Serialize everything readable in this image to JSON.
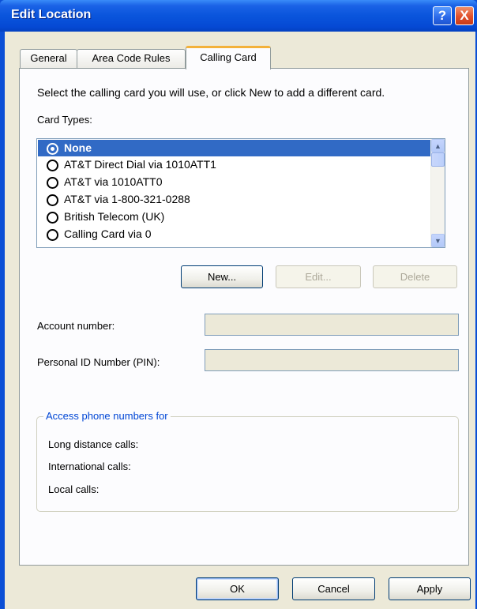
{
  "window": {
    "title": "Edit Location",
    "help_label": "?",
    "close_label": "X"
  },
  "tabs": [
    {
      "label": "General"
    },
    {
      "label": "Area Code Rules"
    },
    {
      "label": "Calling Card",
      "selected": true
    }
  ],
  "instructions": "Select the calling card you will use, or click New to add a different card.",
  "card_types": {
    "label": "Card Types:",
    "items": [
      {
        "label": "None",
        "selected": true
      },
      {
        "label": "AT&T Direct Dial via 1010ATT1"
      },
      {
        "label": "AT&T via 1010ATT0"
      },
      {
        "label": "AT&T via 1-800-321-0288"
      },
      {
        "label": "British Telecom (UK)"
      },
      {
        "label": "Calling Card via 0"
      }
    ]
  },
  "buttons": {
    "new": "New...",
    "edit": "Edit...",
    "delete": "Delete",
    "ok": "OK",
    "cancel": "Cancel",
    "apply": "Apply"
  },
  "fields": {
    "account_number_label": "Account number:",
    "account_number_value": "",
    "pin_label": "Personal ID Number (PIN):",
    "pin_value": ""
  },
  "access_numbers": {
    "title": "Access phone numbers for",
    "long_distance": "Long distance calls:",
    "international": "International calls:",
    "local": "Local calls:"
  },
  "colors": {
    "title_bar": "#0a55dc",
    "selection": "#316ac5",
    "tab_highlight": "#f3b13a",
    "group_title": "#0046d5"
  }
}
